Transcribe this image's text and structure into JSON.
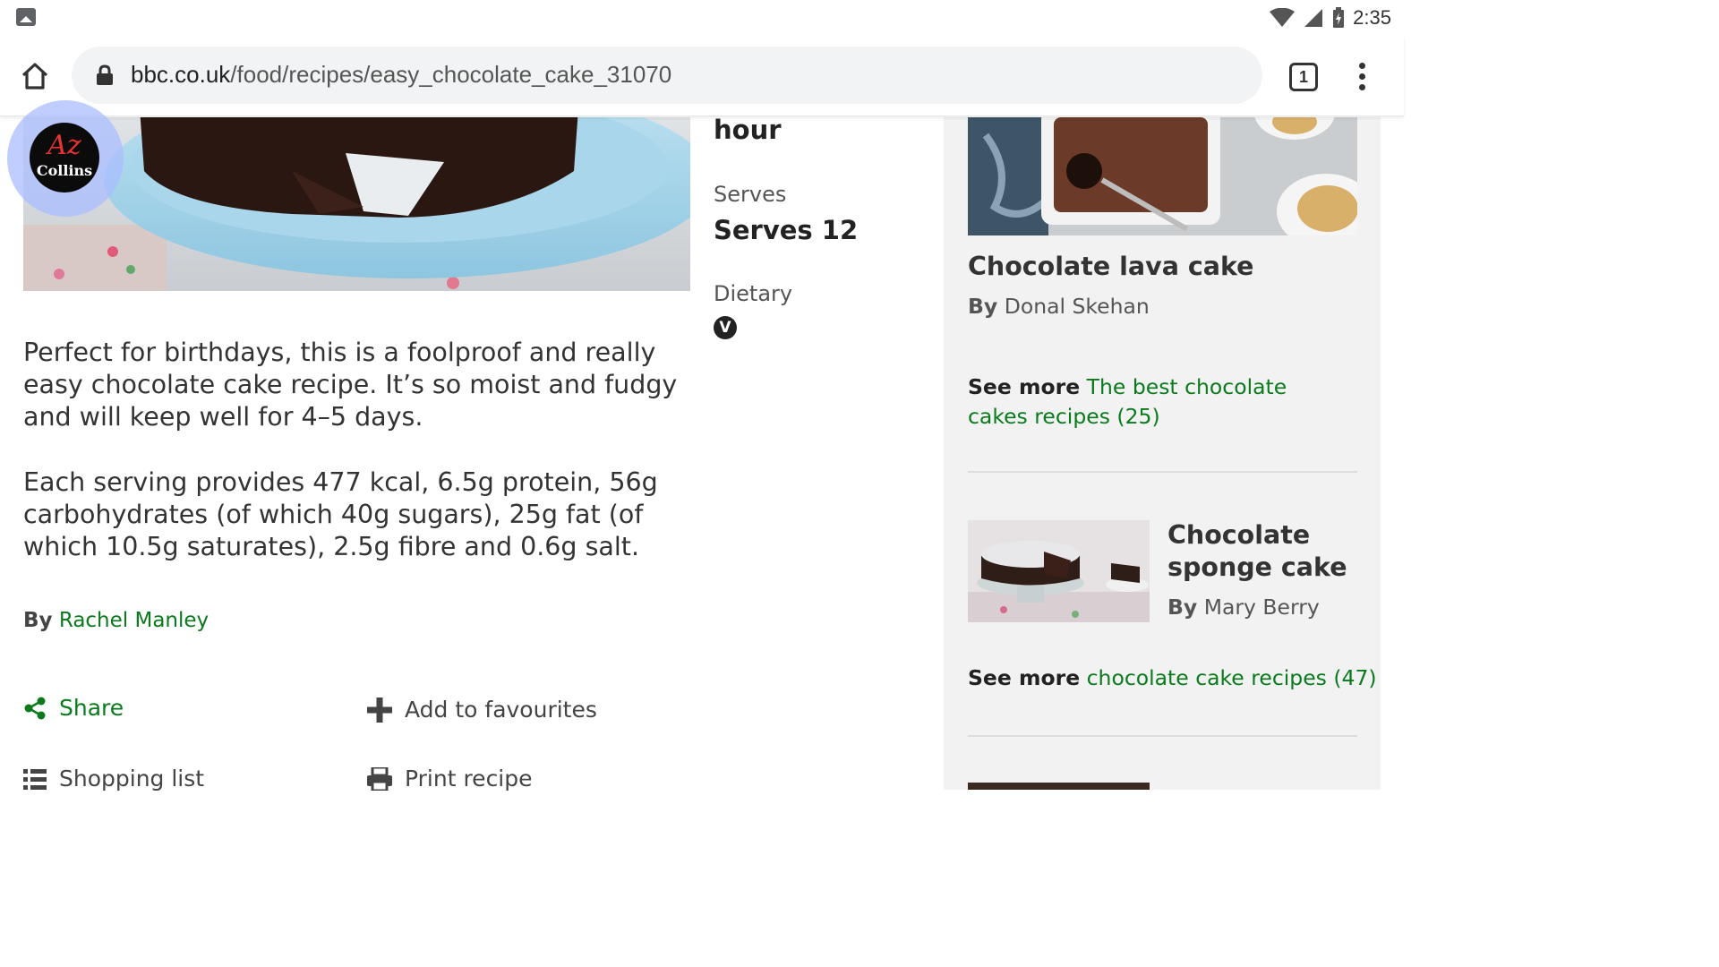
{
  "status_bar": {
    "time": "2:35"
  },
  "browser": {
    "url_domain": "bbc.co.uk",
    "url_path": "/food/recipes/easy_chocolate_cake_31070",
    "tab_count": "1"
  },
  "badge": {
    "logo_text": "Collins",
    "logo_mark": "Az"
  },
  "recipe": {
    "time_tail": "hour",
    "serves_label": "Serves",
    "serves_value": "Serves 12",
    "dietary_label": "Dietary",
    "dietary_badge": "V",
    "description": "Perfect for birthdays, this is a foolproof and really easy chocolate cake recipe. It’s so moist and fudgy and will keep well for 4–5 days.",
    "nutrition": "Each serving provides 477 kcal, 6.5g protein, 56g carbohydrates (of which 40g sugars), 25g fat (of which 10.5g saturates), 2.5g fibre and 0.6g salt.",
    "by_label": "By",
    "author": "Rachel Manley"
  },
  "actions": {
    "share": "Share",
    "favourites": "Add to favourites",
    "shopping": "Shopping list",
    "print": "Print recipe"
  },
  "sidebar": {
    "card1": {
      "title": "Chocolate lava cake",
      "by_label": "By",
      "author": "Donal Skehan"
    },
    "see_more_1": {
      "label": "See more",
      "link": "The best chocolate cakes recipes (25)"
    },
    "card2": {
      "title": "Chocolate sponge cake",
      "by_label": "By",
      "author": "Mary Berry"
    },
    "see_more_2": {
      "label": "See more",
      "link": "chocolate cake recipes (47)"
    }
  },
  "colors": {
    "link": "#0a7a1d",
    "sidebar_bg": "#f2f2f2",
    "text": "#333333"
  }
}
